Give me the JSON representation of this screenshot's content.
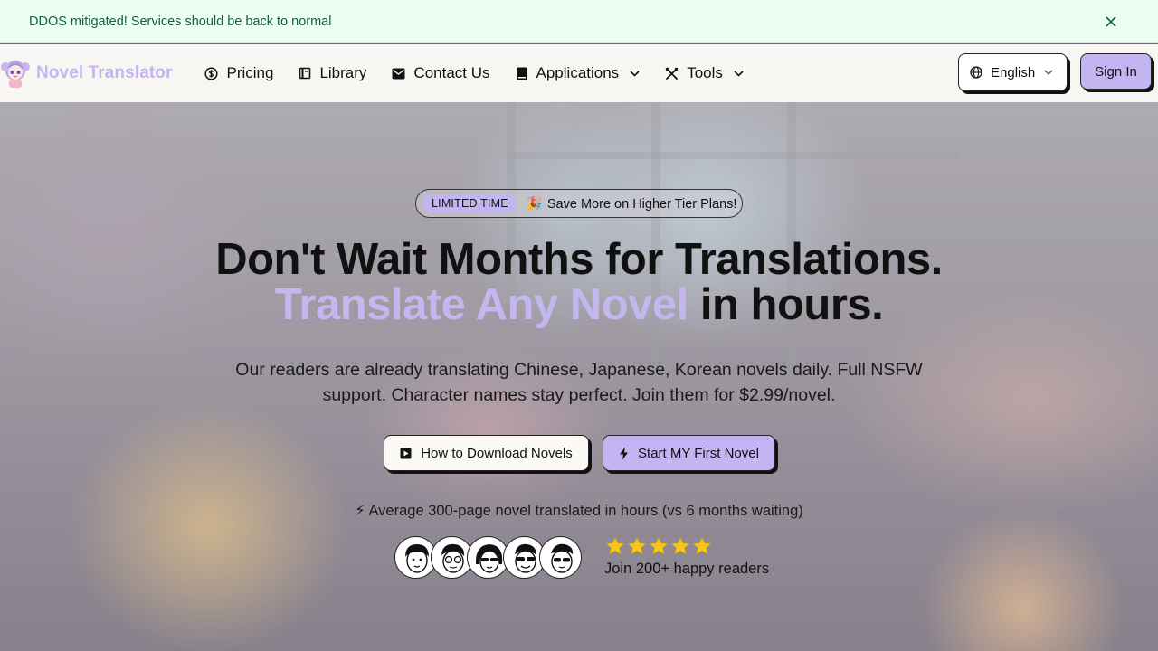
{
  "banner": {
    "text": "DDOS mitigated! Services should be back to normal",
    "close_icon": "close-icon"
  },
  "nav": {
    "brand": "Novel Translator",
    "links": [
      {
        "label": "Pricing",
        "icon": "dollar-circle-icon"
      },
      {
        "label": "Library",
        "icon": "book-icon"
      },
      {
        "label": "Contact Us",
        "icon": "mail-icon"
      },
      {
        "label": "Applications",
        "icon": "app-icon",
        "dropdown": true
      },
      {
        "label": "Tools",
        "icon": "tools-icon",
        "dropdown": true
      }
    ],
    "language": "English",
    "signin": "Sign In"
  },
  "hero": {
    "badge": "LIMITED TIME",
    "promo_emoji": "🎉",
    "promo": "Save More on Higher Tier Plans!",
    "headline_line1": "Don't Wait Months for Translations.",
    "headline_accent": "Translate Any Novel",
    "headline_rest": " in hours.",
    "subtitle": "Our readers are already translating Chinese, Japanese, Korean novels daily. Full NSFW support. Character names stay perfect. Join them for $2.99/novel.",
    "btn_download": "How to Download Novels",
    "btn_start": "Start MY First Novel",
    "stat": "⚡ Average 300-page novel translated in hours (vs 6 months waiting)",
    "rating_stars": 5,
    "join_text": "Join 200+ happy readers"
  },
  "colors": {
    "accent": "#c4b6ef",
    "button_purple": "#c3b5f2",
    "banner_bg": "#ecfdf3",
    "banner_text": "#13623b"
  }
}
